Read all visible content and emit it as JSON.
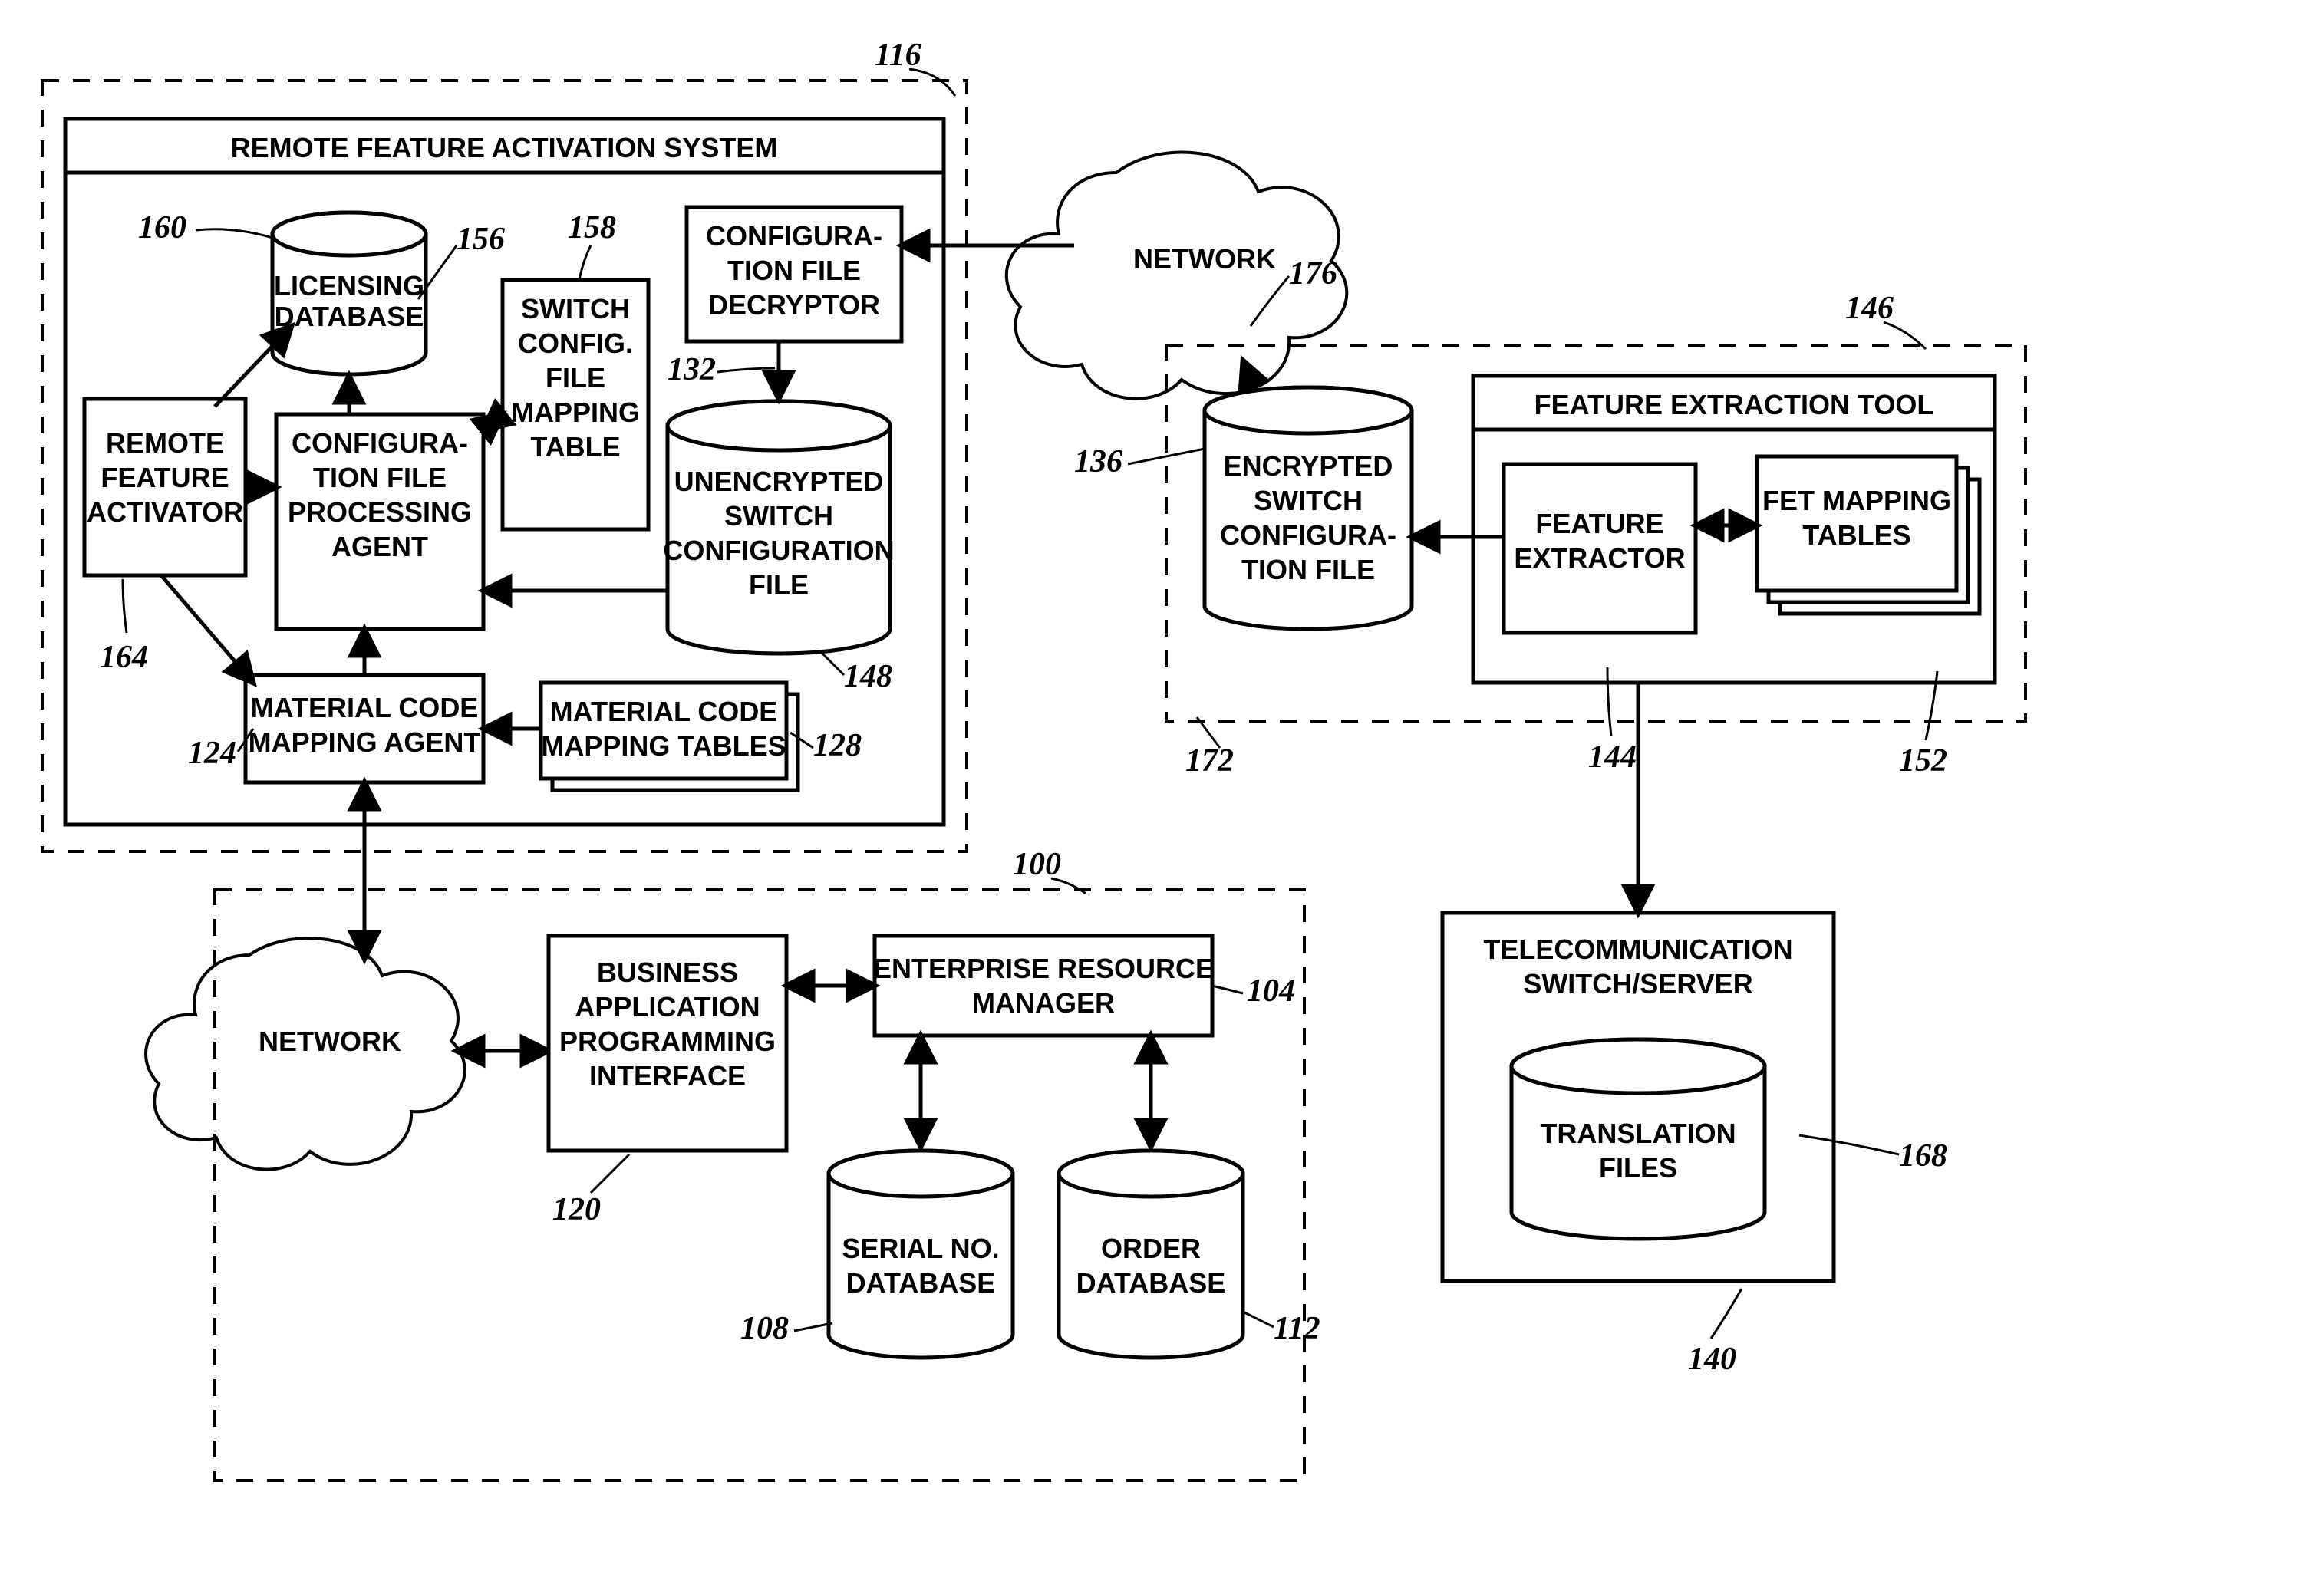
{
  "refs": {
    "r100": "100",
    "r104": "104",
    "r108": "108",
    "r112": "112",
    "r116": "116",
    "r120": "120",
    "r124": "124",
    "r128": "128",
    "r132": "132",
    "r136": "136",
    "r140": "140",
    "r144": "144",
    "r146": "146",
    "r148": "148",
    "r152": "152",
    "r156": "156",
    "r158": "158",
    "r160": "160",
    "r164": "164",
    "r168": "168",
    "r172": "172",
    "r176": "176"
  },
  "labels": {
    "rfas": "REMOTE FEATURE ACTIVATION SYSTEM",
    "licdb": "LICENSING",
    "licdb2": "DATABASE",
    "scfmt1": "SWITCH",
    "scfmt2": "CONFIG.",
    "scfmt3": "FILE",
    "scfmt4": "MAPPING",
    "scfmt5": "TABLE",
    "cfd1": "CONFIGURA-",
    "cfd2": "TION FILE",
    "cfd3": "DECRYPTOR",
    "rfa1": "REMOTE",
    "rfa2": "FEATURE",
    "rfa3": "ACTIVATOR",
    "cfpa1": "CONFIGURA-",
    "cfpa2": "TION FILE",
    "cfpa3": "PROCESSING",
    "cfpa4": "AGENT",
    "uscf1": "UNENCRYPTED",
    "uscf2": "SWITCH",
    "uscf3": "CONFIGURATION",
    "uscf4": "FILE",
    "mcma1": "MATERIAL CODE",
    "mcma2": "MAPPING AGENT",
    "mcmt1": "MATERIAL CODE",
    "mcmt2": "MAPPING TABLES",
    "net": "NETWORK",
    "bapi1": "BUSINESS",
    "bapi2": "APPLICATION",
    "bapi3": "PROGRAMMING",
    "bapi4": "INTERFACE",
    "erm1": "ENTERPRISE RESOURCE",
    "erm2": "MANAGER",
    "sndb1": "SERIAL NO.",
    "sndb2": "DATABASE",
    "odb1": "ORDER",
    "odb2": "DATABASE",
    "fet": "FEATURE EXTRACTION TOOL",
    "fe1": "FEATURE",
    "fe2": "EXTRACTOR",
    "fmt1": "FET MAPPING",
    "fmt2": "TABLES",
    "escf1": "ENCRYPTED",
    "escf2": "SWITCH",
    "escf3": "CONFIGURA-",
    "escf4": "TION FILE",
    "tss1": "TELECOMMUNICATION",
    "tss2": "SWITCH/SERVER",
    "tf1": "TRANSLATION",
    "tf2": "FILES"
  }
}
